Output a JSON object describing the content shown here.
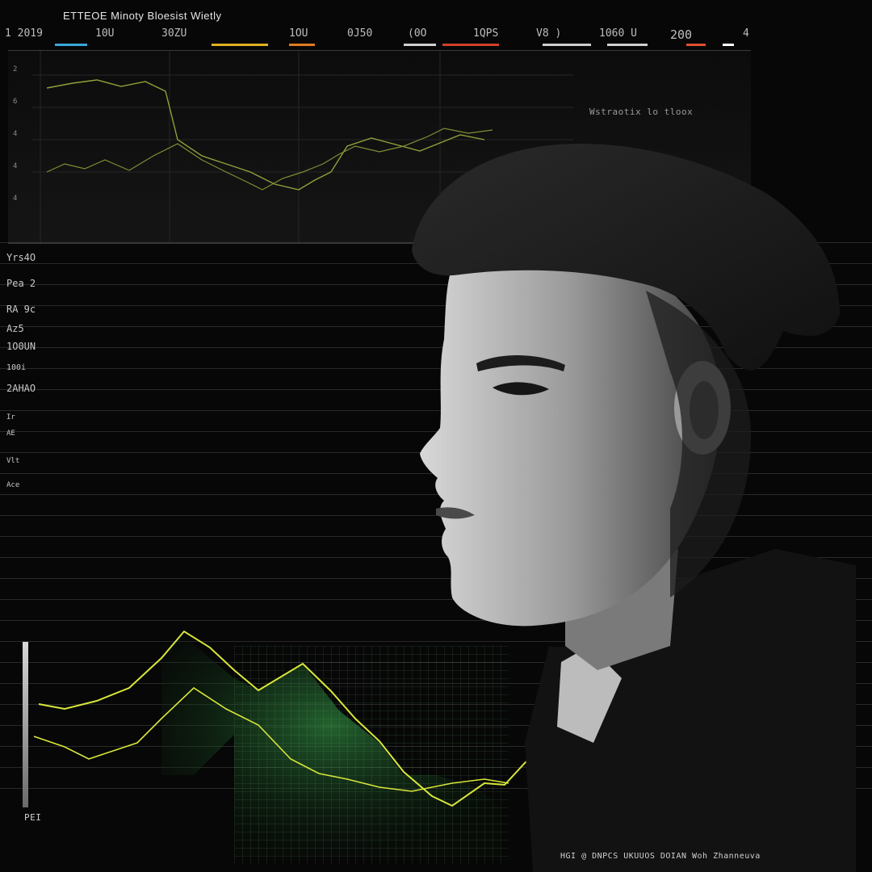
{
  "header": {
    "title": "ETTEOE Minoty Bloesist Wietly"
  },
  "top_axis": {
    "labels": [
      "1 2019",
      "10U",
      "30ZU",
      "1OU",
      "0J50",
      "(0O",
      "1QPS",
      "V8 )",
      "1060 U",
      "200",
      "4"
    ]
  },
  "upper_chart": {
    "note": "Wstraotix lo tloox",
    "y_labels": [
      "2",
      "6",
      "4",
      "4",
      "4"
    ],
    "colors": {
      "line": "#8fa23a"
    }
  },
  "left_labels": [
    "Yrs4O",
    "Pea 2",
    "RA 9c",
    "Az5",
    "1O0UN",
    "100i",
    "2AHAO",
    "Ir",
    "AE",
    "Vlt",
    "Ace"
  ],
  "lower_chart": {
    "bar_label": "PEI",
    "colors": {
      "yellow": "#d8e63a",
      "green": "#2f8a40",
      "teal": "#1aa5b5"
    }
  },
  "footer": {
    "caption": "HGI @ DNPCS UKUUOS DOIAN Woh Zhanneuva"
  },
  "portrait": {
    "icon": "man-profile-portrait"
  }
}
